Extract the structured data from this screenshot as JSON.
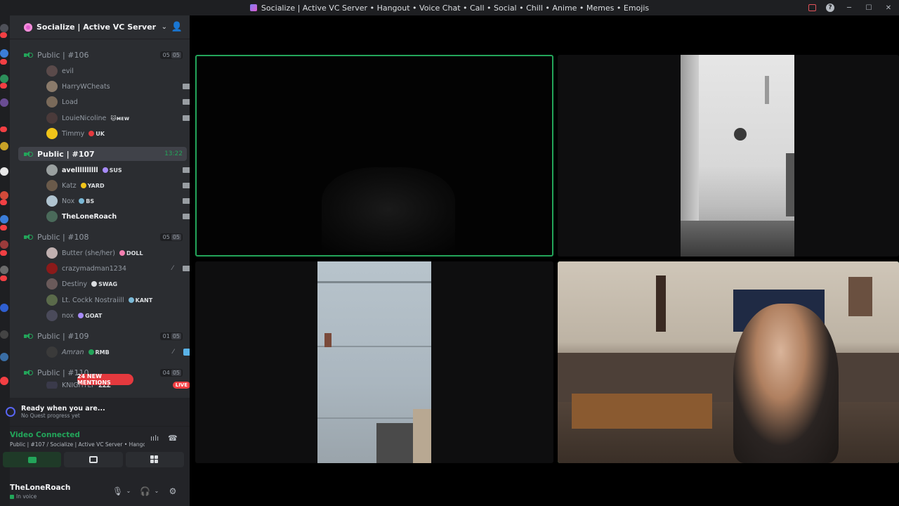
{
  "window": {
    "title": "Socialize | Active VC Server • Hangout • Voice Chat • Call • Social • Chill • Anime • Memes • Emojis",
    "controls": [
      "inbox-icon",
      "help-icon",
      "minimize-icon",
      "maximize-icon",
      "close-icon"
    ]
  },
  "server": {
    "name": "Socialize | Active VC Server • Han...",
    "accent": "#e05ccf"
  },
  "channels": [
    {
      "name": "Public | #106",
      "count": [
        "05",
        "05"
      ],
      "members": [
        {
          "name": "evil",
          "tag": ""
        },
        {
          "name": "HarryWCheats",
          "tag": ""
        },
        {
          "name": "Load",
          "tag": ""
        },
        {
          "name": "LouieNicoline",
          "tag": "🐱ᴍᴇᴡ"
        },
        {
          "name": "Timmy",
          "tag": "UK"
        }
      ]
    },
    {
      "name": "Public | #107",
      "timer": "13:22",
      "active": true,
      "members": [
        {
          "name": "avellllllllll",
          "tag": "SUS"
        },
        {
          "name": "Katz",
          "tag": "YARD"
        },
        {
          "name": "Nox",
          "tag": "BS"
        },
        {
          "name": "TheLoneRoach",
          "tag": ""
        }
      ]
    },
    {
      "name": "Public | #108",
      "count": [
        "05",
        "05"
      ],
      "members": [
        {
          "name": "Butter (she/her)",
          "tag": "DOLL"
        },
        {
          "name": "crazymadman1234",
          "tag": ""
        },
        {
          "name": "Destiny",
          "tag": "SWAG"
        },
        {
          "name": "Lt. Cockk Nostraiill",
          "tag": "KANT"
        },
        {
          "name": "nox",
          "tag": "GOAT"
        }
      ]
    },
    {
      "name": "Public | #109",
      "count": [
        "01",
        "05"
      ],
      "members": [
        {
          "name": "Amran",
          "tag": "RMB"
        }
      ]
    },
    {
      "name": "Public | #110",
      "count": [
        "04",
        "05"
      ],
      "members": [
        {
          "name": "KNIGHTLY",
          "tag": "ZZZ",
          "live": "LIVE"
        }
      ]
    }
  ],
  "mentions_pill": "24 NEW MENTIONS",
  "quest": {
    "title": "Ready when you are...",
    "subtitle": "No Quest progress yet"
  },
  "voice": {
    "status": "Video Connected",
    "channel": "Public | #107 / Socialize | Active VC Server • Hango..."
  },
  "user": {
    "name": "TheLoneRoach",
    "status": "In voice"
  },
  "colors": {
    "speaking": "#23a55a",
    "sidebar_bg": "#2b2d31",
    "mention": "#e5393e"
  }
}
